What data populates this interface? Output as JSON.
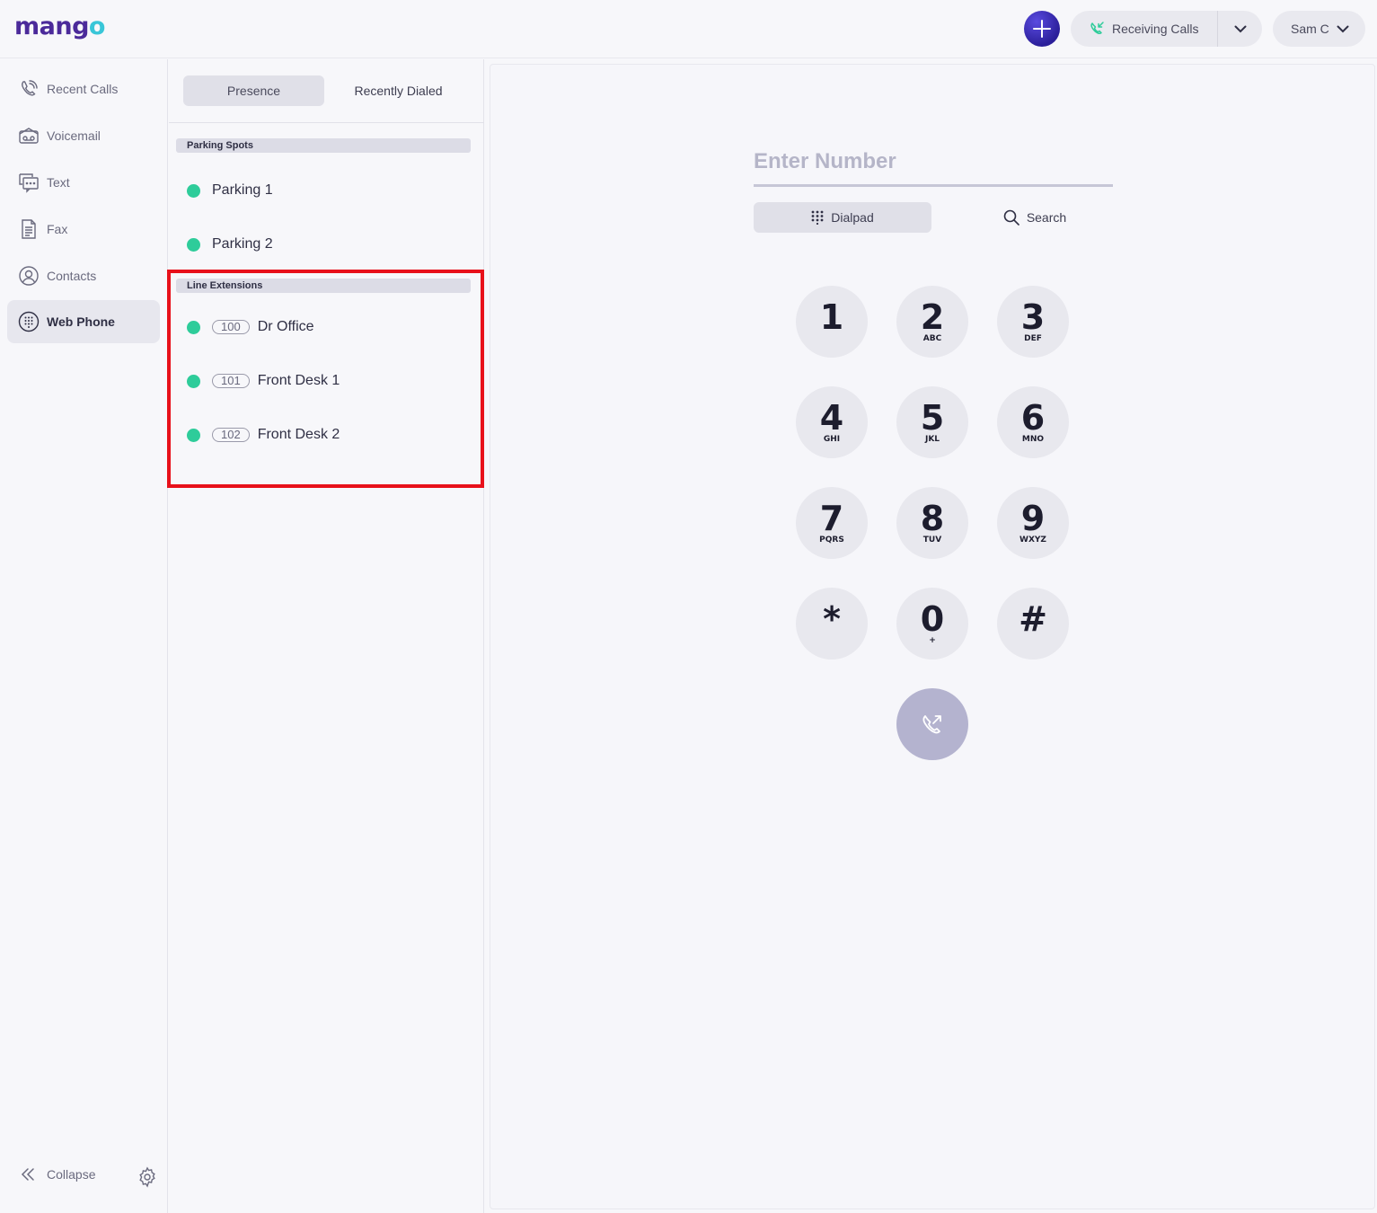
{
  "header": {
    "logo_main": "mang",
    "logo_accent": "o",
    "status_label": "Receiving Calls",
    "user_name": "Sam C"
  },
  "sidebar": {
    "items": [
      {
        "label": "Recent Calls",
        "icon": "recent-calls-icon"
      },
      {
        "label": "Voicemail",
        "icon": "voicemail-icon"
      },
      {
        "label": "Text",
        "icon": "text-message-icon"
      },
      {
        "label": "Fax",
        "icon": "fax-icon"
      },
      {
        "label": "Contacts",
        "icon": "contacts-icon"
      },
      {
        "label": "Web Phone",
        "icon": "dialpad-icon",
        "active": true
      }
    ],
    "collapse_label": "Collapse"
  },
  "middle": {
    "tabs": [
      {
        "label": "Presence",
        "active": true
      },
      {
        "label": "Recently Dialed",
        "active": false
      }
    ],
    "parking_header": "Parking Spots",
    "parking": [
      {
        "name": "Parking 1"
      },
      {
        "name": "Parking 2"
      }
    ],
    "lines_header": "Line Extensions",
    "lines": [
      {
        "ext": "100",
        "name": "Dr Office"
      },
      {
        "ext": "101",
        "name": "Front Desk 1"
      },
      {
        "ext": "102",
        "name": "Front Desk 2"
      }
    ],
    "status_color": "#2ecc9a"
  },
  "dialer": {
    "placeholder": "Enter Number",
    "modes": [
      {
        "label": "Dialpad",
        "active": true
      },
      {
        "label": "Search",
        "active": false
      }
    ],
    "keys": [
      {
        "digit": "1",
        "letters": ""
      },
      {
        "digit": "2",
        "letters": "ABC"
      },
      {
        "digit": "3",
        "letters": "DEF"
      },
      {
        "digit": "4",
        "letters": "GHI"
      },
      {
        "digit": "5",
        "letters": "JKL"
      },
      {
        "digit": "6",
        "letters": "MNO"
      },
      {
        "digit": "7",
        "letters": "PQRS"
      },
      {
        "digit": "8",
        "letters": "TUV"
      },
      {
        "digit": "9",
        "letters": "WXYZ"
      },
      {
        "digit": "*",
        "letters": ""
      },
      {
        "digit": "0",
        "letters": "+"
      },
      {
        "digit": "#",
        "letters": ""
      }
    ]
  },
  "colors": {
    "brand": "#4b2a9a",
    "brand_accent": "#39c6d8",
    "highlight": "#e8101a",
    "call_button": "#b4b3cf"
  }
}
